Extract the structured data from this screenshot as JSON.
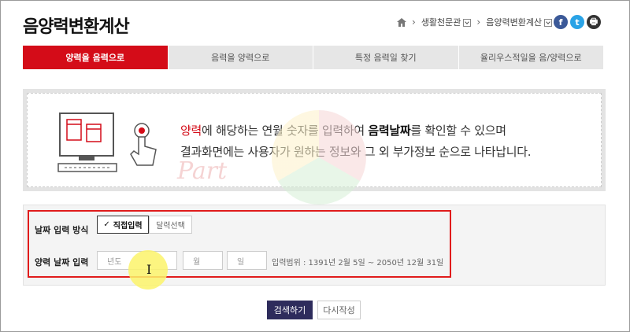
{
  "page_title": "음양력변환계산",
  "breadcrumb": {
    "home_icon": "home-icon",
    "items": [
      "생활천문관",
      "음양력변환계산"
    ]
  },
  "social": {
    "facebook": "f",
    "twitter": "t",
    "print": "🖶"
  },
  "tabs": [
    {
      "label": "양력을 음력으로",
      "active": true
    },
    {
      "label": "음력을 양력으로",
      "active": false
    },
    {
      "label": "특정 음력일 찾기",
      "active": false
    },
    {
      "label": "율리우스적일을 음/양력으로",
      "active": false
    }
  ],
  "info": {
    "line1_red": "양력",
    "line1_a": "에 해당하는 연월 숫자를 입력하여 ",
    "line1_bold": "음력날짜",
    "line1_b": "를 확인할 수 있으며",
    "line2": "결과화면에는 사용자가 원하는 정보와 그 외 부가정보 순으로 나타납니다."
  },
  "watermark_text": "Part",
  "form": {
    "mode_label": "날짜 입력 방식",
    "mode_direct": "직접입력",
    "mode_calendar": "달력선택",
    "date_label": "양력 날짜 입력",
    "year_placeholder": "년도",
    "month_placeholder": "월",
    "day_placeholder": "일",
    "range_text": "입력범위 : 1391년 2월 5일 ~ 2050년 12월 31일"
  },
  "buttons": {
    "search": "검색하기",
    "reset": "다시작성"
  },
  "colors": {
    "accent_red": "#d40c18",
    "search_btn": "#2e2c5c"
  }
}
